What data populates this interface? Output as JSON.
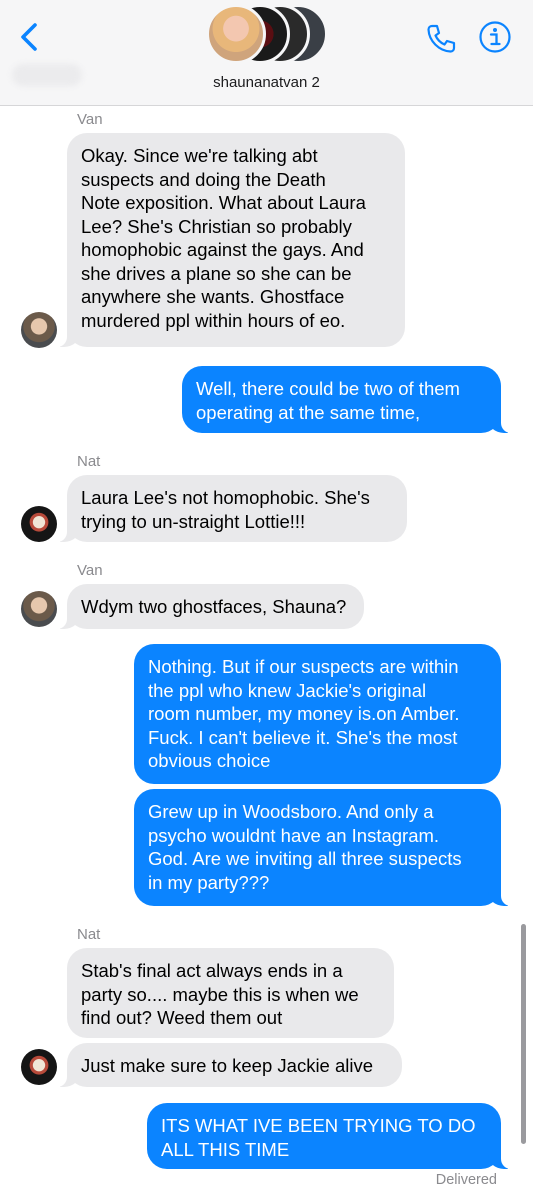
{
  "header": {
    "group_name": "shaunanatvan 2",
    "back_icon": "chevron-left-icon",
    "call_icon": "phone-icon",
    "info_icon": "info-icon",
    "accent": "#0b84ff"
  },
  "colors": {
    "outgoing_bubble": "#0b84ff",
    "incoming_bubble": "#e9e9eb",
    "meta_text": "#8a8a8e"
  },
  "messages": [
    {
      "sender": "Van",
      "direction": "incoming",
      "lines": [
        "Okay. Since we're talking abt",
        "suspects and doing the Death",
        "Note exposition. What about Laura",
        "Lee? She's Christian so probably",
        "homophobic against the gays. And",
        "she drives a plane so she can be",
        "anywhere she wants. Ghostface",
        "murdered ppl within hours of eo."
      ]
    },
    {
      "sender": "Shauna",
      "direction": "outgoing",
      "lines": [
        "Well, there could be two of them",
        "operating at the same time,"
      ]
    },
    {
      "sender": "Nat",
      "direction": "incoming",
      "lines": [
        "Laura Lee's not homophobic. She's",
        "trying to un-straight Lottie!!!"
      ]
    },
    {
      "sender": "Van",
      "direction": "incoming",
      "lines": [
        "Wdym two ghostfaces, Shauna?"
      ]
    },
    {
      "sender": "Shauna",
      "direction": "outgoing",
      "lines": [
        "Nothing. But if our suspects are within",
        "the ppl who knew Jackie's original",
        "room number, my money is.on Amber.",
        "Fuck. I can't believe it. She's the most",
        "obvious choice"
      ]
    },
    {
      "sender": "Shauna",
      "direction": "outgoing",
      "lines": [
        "Grew up in Woodsboro. And only a",
        "psycho wouldnt have an Instagram.",
        "God. Are we inviting all three suspects",
        "in my party???"
      ]
    },
    {
      "sender": "Nat",
      "direction": "incoming",
      "lines": [
        "Stab's final act always ends in a",
        "party so.... maybe this is when we",
        "find out? Weed them out"
      ]
    },
    {
      "sender": "Nat",
      "direction": "incoming",
      "lines": [
        "Just make sure to keep Jackie alive"
      ]
    },
    {
      "sender": "Shauna",
      "direction": "outgoing",
      "lines": [
        "ITS WHAT IVE BEEN TRYING TO DO",
        "ALL THIS TIME"
      ]
    }
  ],
  "status": {
    "delivered": "Delivered"
  }
}
